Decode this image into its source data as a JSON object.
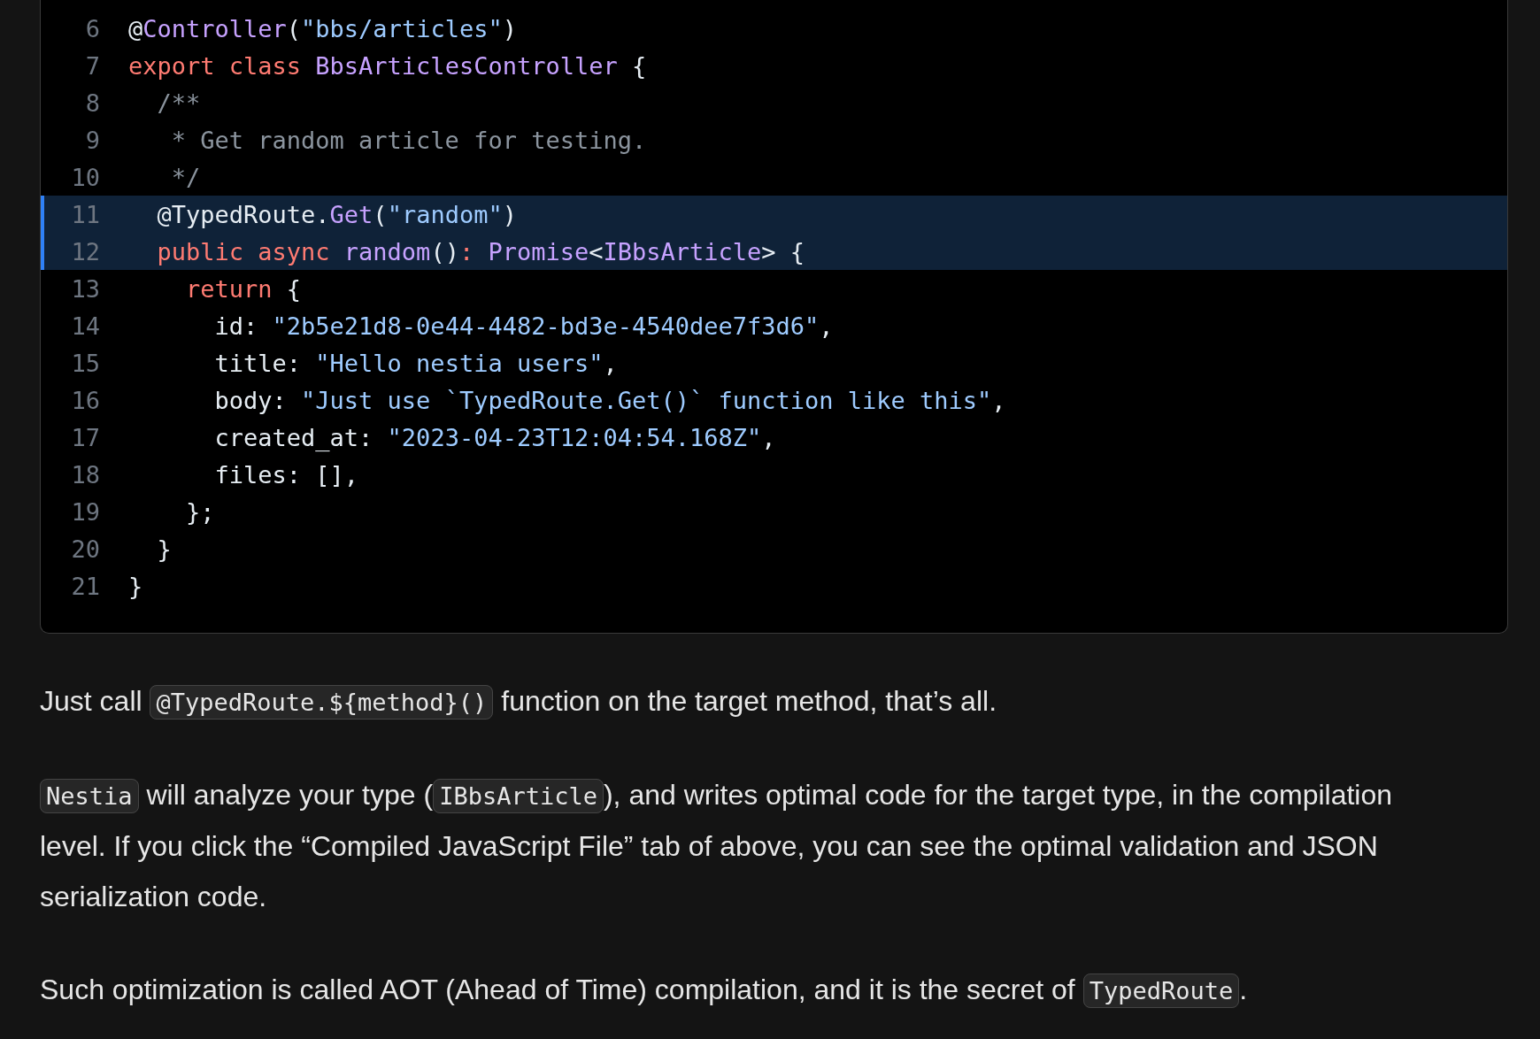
{
  "code_block": {
    "lines": [
      {
        "number": "6",
        "highlighted": false,
        "tokens": [
          {
            "kind": "plain",
            "text": "@"
          },
          {
            "kind": "func",
            "text": "Controller"
          },
          {
            "kind": "plain",
            "text": "("
          },
          {
            "kind": "string",
            "text": "\"bbs/articles\""
          },
          {
            "kind": "plain",
            "text": ")"
          }
        ]
      },
      {
        "number": "7",
        "highlighted": false,
        "tokens": [
          {
            "kind": "keyword",
            "text": "export class "
          },
          {
            "kind": "func",
            "text": "BbsArticlesController"
          },
          {
            "kind": "plain",
            "text": " {"
          }
        ]
      },
      {
        "number": "8",
        "highlighted": false,
        "tokens": [
          {
            "kind": "comment",
            "text": "  /**"
          }
        ]
      },
      {
        "number": "9",
        "highlighted": false,
        "tokens": [
          {
            "kind": "comment",
            "text": "   * Get random article for testing."
          }
        ]
      },
      {
        "number": "10",
        "highlighted": false,
        "tokens": [
          {
            "kind": "comment",
            "text": "   */"
          }
        ]
      },
      {
        "number": "11",
        "highlighted": true,
        "tokens": [
          {
            "kind": "plain",
            "text": "  @TypedRoute."
          },
          {
            "kind": "func",
            "text": "Get"
          },
          {
            "kind": "plain",
            "text": "("
          },
          {
            "kind": "string",
            "text": "\"random\""
          },
          {
            "kind": "plain",
            "text": ")"
          }
        ]
      },
      {
        "number": "12",
        "highlighted": true,
        "tokens": [
          {
            "kind": "keyword",
            "text": "  public async "
          },
          {
            "kind": "func",
            "text": "random"
          },
          {
            "kind": "plain",
            "text": "()"
          },
          {
            "kind": "keyword",
            "text": ": "
          },
          {
            "kind": "func",
            "text": "Promise"
          },
          {
            "kind": "plain",
            "text": "<"
          },
          {
            "kind": "func",
            "text": "IBbsArticle"
          },
          {
            "kind": "plain",
            "text": "> {"
          }
        ]
      },
      {
        "number": "13",
        "highlighted": false,
        "tokens": [
          {
            "kind": "keyword",
            "text": "    return"
          },
          {
            "kind": "plain",
            "text": " {"
          }
        ]
      },
      {
        "number": "14",
        "highlighted": false,
        "tokens": [
          {
            "kind": "plain",
            "text": "      id: "
          },
          {
            "kind": "string",
            "text": "\"2b5e21d8-0e44-4482-bd3e-4540dee7f3d6\""
          },
          {
            "kind": "plain",
            "text": ","
          }
        ]
      },
      {
        "number": "15",
        "highlighted": false,
        "tokens": [
          {
            "kind": "plain",
            "text": "      title: "
          },
          {
            "kind": "string",
            "text": "\"Hello nestia users\""
          },
          {
            "kind": "plain",
            "text": ","
          }
        ]
      },
      {
        "number": "16",
        "highlighted": false,
        "tokens": [
          {
            "kind": "plain",
            "text": "      body: "
          },
          {
            "kind": "string",
            "text": "\"Just use `TypedRoute.Get()` function like this\""
          },
          {
            "kind": "plain",
            "text": ","
          }
        ]
      },
      {
        "number": "17",
        "highlighted": false,
        "tokens": [
          {
            "kind": "plain",
            "text": "      created_at: "
          },
          {
            "kind": "string",
            "text": "\"2023-04-23T12:04:54.168Z\""
          },
          {
            "kind": "plain",
            "text": ","
          }
        ]
      },
      {
        "number": "18",
        "highlighted": false,
        "tokens": [
          {
            "kind": "plain",
            "text": "      files: [],"
          }
        ]
      },
      {
        "number": "19",
        "highlighted": false,
        "tokens": [
          {
            "kind": "plain",
            "text": "    };"
          }
        ]
      },
      {
        "number": "20",
        "highlighted": false,
        "tokens": [
          {
            "kind": "plain",
            "text": "  }"
          }
        ]
      },
      {
        "number": "21",
        "highlighted": false,
        "tokens": [
          {
            "kind": "plain",
            "text": "}"
          }
        ]
      }
    ]
  },
  "paragraphs": [
    [
      {
        "kind": "text",
        "text": "Just call "
      },
      {
        "kind": "code",
        "text": "@TypedRoute.${method}()"
      },
      {
        "kind": "text",
        "text": " function on the target method, that’s all."
      }
    ],
    [
      {
        "kind": "code",
        "text": "Nestia"
      },
      {
        "kind": "text",
        "text": " will analyze your type ("
      },
      {
        "kind": "code",
        "text": "IBbsArticle"
      },
      {
        "kind": "text",
        "text": "), and writes optimal code for the target type, in the compilation"
      },
      {
        "kind": "text_line",
        "text": "level. If you click the “Compiled JavaScript File” tab of above, you can see the optimal validation and JSON"
      },
      {
        "kind": "text_line",
        "text": "serialization code."
      }
    ],
    [
      {
        "kind": "text",
        "text": "Such optimization is called AOT (Ahead of Time) compilation, and it is the secret of "
      },
      {
        "kind": "code",
        "text": "TypedRoute"
      },
      {
        "kind": "text",
        "text": "."
      }
    ]
  ]
}
